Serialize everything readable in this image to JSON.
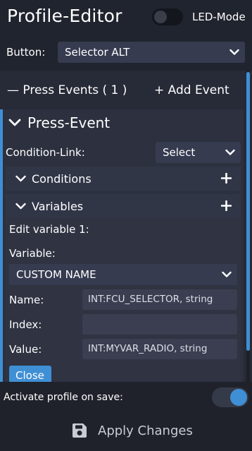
{
  "header": {
    "title": "Profile-Editor",
    "led_mode_label": "LED-Mode",
    "led_mode_on": false
  },
  "button_select": {
    "label": "Button:",
    "value": "Selector ALT"
  },
  "press_events": {
    "header": "— Press Events ( 1 )",
    "add_label": "+ Add Event"
  },
  "press_event": {
    "title": "Press-Event",
    "condition_link_label": "Condition-Link:",
    "condition_link_value": "Select",
    "conditions_label": "Conditions",
    "variables_label": "Variables"
  },
  "variable_editor": {
    "heading": "Edit variable 1:",
    "variable_label": "Variable:",
    "variable_value": "CUSTOM NAME",
    "name_label": "Name:",
    "name_value": "INT:FCU_SELECTOR, string",
    "index_label": "Index:",
    "index_value": "",
    "value_label": "Value:",
    "value_value": "INT:MYVAR_RADIO, string",
    "close_label": "Close"
  },
  "footer": {
    "activate_label": "Activate profile on save:",
    "activate_on": true,
    "apply_label": "Apply Changes"
  },
  "colors": {
    "accent": "#3f8fd5",
    "background": "#20242e",
    "panel": "#2c303f",
    "control": "#363b50"
  },
  "icons": [
    "chevron-down-icon",
    "plus-icon",
    "save-icon"
  ]
}
